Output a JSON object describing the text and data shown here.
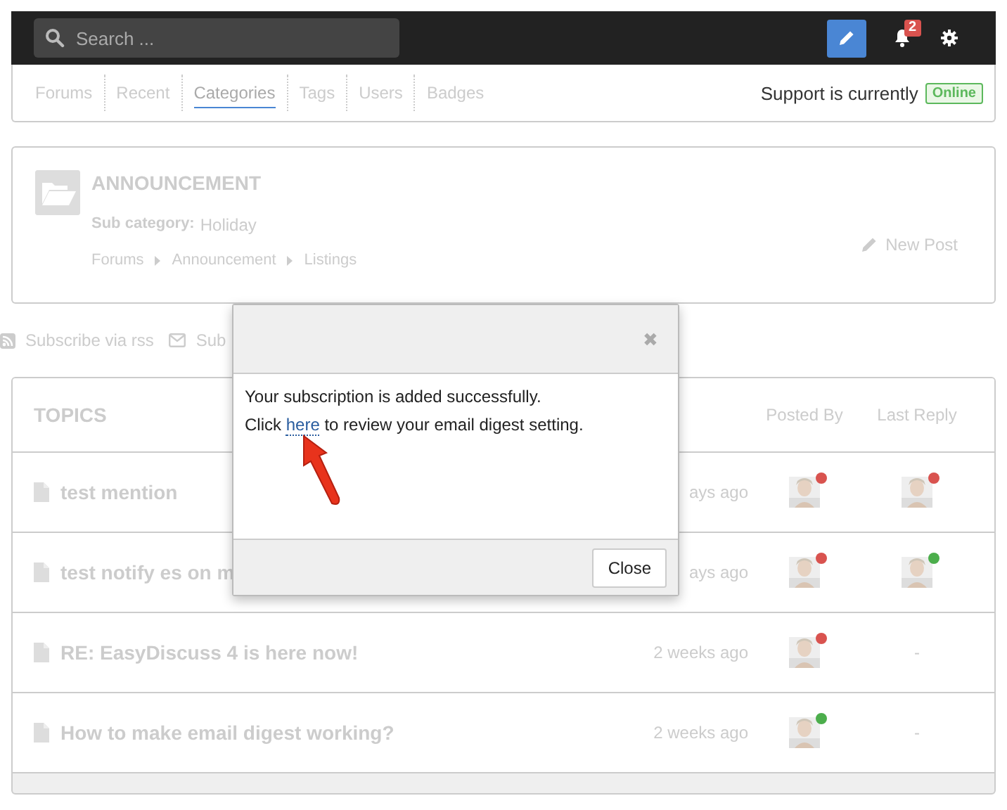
{
  "search": {
    "placeholder": "Search ..."
  },
  "toolbar": {
    "notification_count": "2"
  },
  "nav": {
    "tabs": [
      {
        "label": "Forums",
        "selected": false
      },
      {
        "label": "Recent",
        "selected": false
      },
      {
        "label": "Categories",
        "selected": true
      },
      {
        "label": "Tags",
        "selected": false
      },
      {
        "label": "Users",
        "selected": false
      },
      {
        "label": "Badges",
        "selected": false
      }
    ],
    "support_label": "Support is currently",
    "support_status": "Online"
  },
  "category": {
    "title": "ANNOUNCEMENT",
    "sub_label": "Sub category:",
    "sub_value": "Holiday",
    "breadcrumbs": [
      "Forums",
      "Announcement",
      "Listings"
    ],
    "new_post": "New Post"
  },
  "subscribe": [
    {
      "kind": "rss",
      "label": "Subscribe via rss"
    },
    {
      "kind": "email",
      "label": "Sub"
    }
  ],
  "topics": {
    "title": "TOPICS",
    "columns": [
      "Posted By",
      "Last Reply"
    ],
    "rows": [
      {
        "title": "test mention",
        "time": "ays ago",
        "poster_status": {
          "color": "#d9534f"
        },
        "last_reply": {
          "kind": "avatar",
          "color": "#d9534f"
        }
      },
      {
        "title": "test notify es on m",
        "time": "ays ago",
        "poster_status": {
          "color": "#d9534f"
        },
        "last_reply": {
          "kind": "avatar",
          "color": "#4cae4c"
        }
      },
      {
        "title": "RE: EasyDiscuss 4 is here now!",
        "time": "2 weeks ago",
        "poster_status": {
          "color": "#d9534f"
        },
        "last_reply": {
          "kind": "none",
          "text": "-"
        }
      },
      {
        "title": "How to make email digest working?",
        "time": "2 weeks ago",
        "poster_status": {
          "color": "#4cae4c"
        },
        "last_reply": {
          "kind": "none",
          "text": "-"
        }
      }
    ]
  },
  "dialog": {
    "close_symbol": "✖",
    "message": "Your subscription is added successfully.",
    "link_before": "Click",
    "link": "here",
    "link_after": "to review your email digest setting.",
    "button": "Close"
  }
}
